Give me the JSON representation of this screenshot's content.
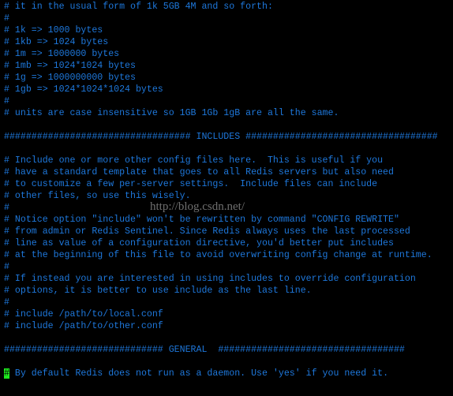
{
  "lines": [
    "# it in the usual form of 1k 5GB 4M and so forth:",
    "#",
    "# 1k => 1000 bytes",
    "# 1kb => 1024 bytes",
    "# 1m => 1000000 bytes",
    "# 1mb => 1024*1024 bytes",
    "# 1g => 1000000000 bytes",
    "# 1gb => 1024*1024*1024 bytes",
    "#",
    "# units are case insensitive so 1GB 1Gb 1gB are all the same.",
    "",
    "################################## INCLUDES ###################################",
    "",
    "# Include one or more other config files here.  This is useful if you",
    "# have a standard template that goes to all Redis servers but also need",
    "# to customize a few per-server settings.  Include files can include",
    "# other files, so use this wisely.",
    "#",
    "# Notice option \"include\" won't be rewritten by command \"CONFIG REWRITE\"",
    "# from admin or Redis Sentinel. Since Redis always uses the last processed",
    "# line as value of a configuration directive, you'd better put includes",
    "# at the beginning of this file to avoid overwriting config change at runtime.",
    "#",
    "# If instead you are interested in using includes to override configuration",
    "# options, it is better to use include as the last line.",
    "#",
    "# include /path/to/local.conf",
    "# include /path/to/other.conf",
    "",
    "############################# GENERAL  ##################################",
    ""
  ],
  "cursor_line": {
    "cursor_char": "#",
    "rest": " By default Redis does not run as a daemon. Use 'yes' if you need it."
  },
  "watermark": "http://blog.csdn.net/",
  "colors": {
    "text": "#1e78dc",
    "cursor": "#1ee61e",
    "background": "#000000"
  }
}
